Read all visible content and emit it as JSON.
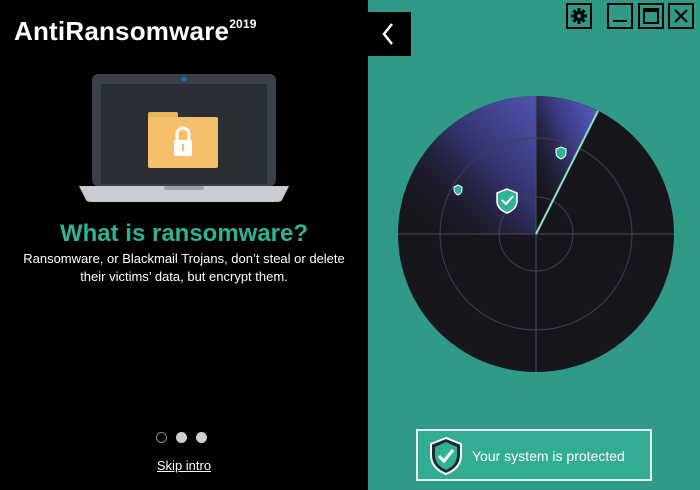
{
  "app": {
    "title": "AntiRansomware",
    "year": "2019"
  },
  "intro": {
    "headline": "What is ransomware?",
    "description": "Ransomware, or Blackmail Trojans, don’t steal or delete their victims’ data, but encrypt them.",
    "pagination": {
      "total": 3,
      "active_indices": [
        1,
        2
      ]
    },
    "skip_label": "Skip intro"
  },
  "status": {
    "text": "Your system is protected"
  },
  "colors": {
    "accent": "#2fb394",
    "teal_panel": "#2f9a86",
    "radar_sweep": "#5a5fc8",
    "radar_bg": "#17161c"
  },
  "icons": {
    "back": "chevron-left-icon",
    "settings": "gear-icon",
    "minimize": "minimize-icon",
    "maximize": "maximize-icon",
    "close": "close-icon",
    "laptop": "laptop-folder-lock-icon",
    "shield": "shield-check-icon"
  }
}
